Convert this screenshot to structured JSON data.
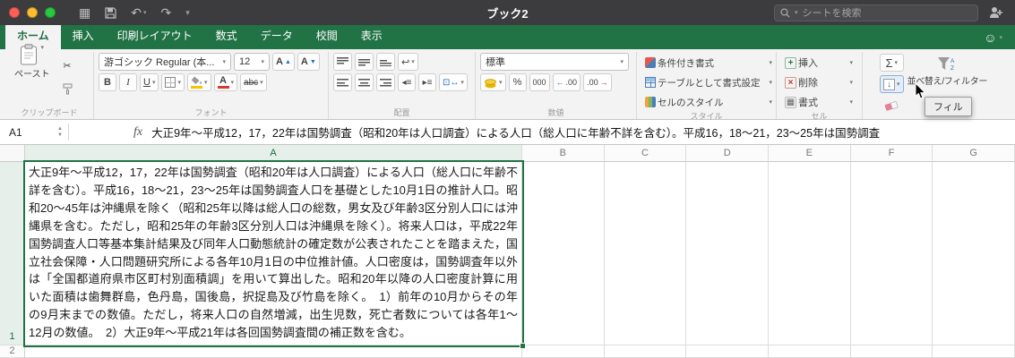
{
  "titlebar": {
    "title": "ブック2",
    "search_placeholder": "シートを検索"
  },
  "tabs": {
    "items": [
      {
        "label": "ホーム"
      },
      {
        "label": "挿入"
      },
      {
        "label": "印刷レイアウト"
      },
      {
        "label": "数式"
      },
      {
        "label": "データ"
      },
      {
        "label": "校閲"
      },
      {
        "label": "表示"
      }
    ]
  },
  "ribbon": {
    "groups": {
      "clipboard": "クリップボード",
      "font": "フォント",
      "alignment": "配置",
      "number": "数値",
      "style": "スタイル",
      "cell": "セル"
    },
    "paste_label": "ペースト",
    "font_name": "游ゴシック Regular (本...",
    "font_size": "12",
    "bold": "B",
    "italic": "I",
    "underline": "U",
    "strike": "abc",
    "grow_font": "A",
    "shrink_font": "A",
    "font_color_letter": "A",
    "orientation": "ab",
    "number_format": "標準",
    "percent": "%",
    "thousands": "000",
    "decimal": ".00",
    "conditional_format": "条件付き書式",
    "format_as_table": "テーブルとして書式設定",
    "cell_styles": "セルのスタイル",
    "insert": "挿入",
    "delete": "削除",
    "format": "書式",
    "autosum": "Σ",
    "sort_filter": "並べ替え/フィルター",
    "tooltip_fill": "フィル"
  },
  "formula_bar": {
    "name_box": "A1",
    "fx": "fx",
    "formula": "大正9年〜平成12，17，22年は国勢調査（昭和20年は人口調査）による人口（総人口に年齢不詳を含む）。平成16，18〜21，23〜25年は国勢調査"
  },
  "sheet": {
    "columns": [
      "A",
      "B",
      "C",
      "D",
      "E",
      "F",
      "G"
    ],
    "rows": [
      "1",
      "2"
    ],
    "a1_text": "大正9年〜平成12，17，22年は国勢調査（昭和20年は人口調査）による人口（総人口に年齢不詳を含む）。平成16，18〜21，23〜25年は国勢調査人口を基礎とした10月1日の推計人口。昭和20〜45年は沖縄県を除く（昭和25年以降は総人口の総数，男女及び年齢3区分別人口には沖縄県を含む。ただし，昭和25年の年齢3区分別人口は沖縄県を除く）。将来人口は，平成22年国勢調査人口等基本集計結果及び同年人口動態統計の確定数が公表されたことを踏まえた，国立社会保障・人口問題研究所による各年10月1日の中位推計値。人口密度は，国勢調査年以外は「全国都道府県市区町村別面積調」を用いて算出した。昭和20年以降の人口密度計算に用いた面積は歯舞群島，色丹島，国後島，択捉島及び竹島を除く。　1）前年の10月からその年の9月末までの数値。ただし，将来人口の自然増減，出生児数，死亡者数については各年1〜12月の数値。　2）大正9年〜平成21年は各回国勢調査間の補正数を含む。"
  },
  "colors": {
    "excel_green": "#217346",
    "selection_border": "#217346",
    "traffic_red": "#ff5f57",
    "traffic_yellow": "#febc2e",
    "traffic_green": "#28c840"
  }
}
